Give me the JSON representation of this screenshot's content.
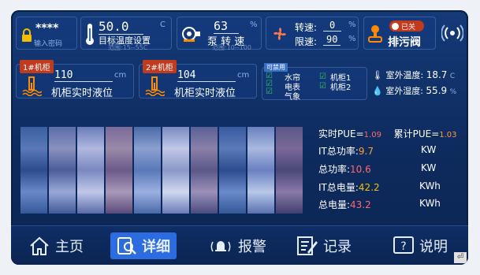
{
  "password": {
    "stars": "****",
    "label": "输入密码"
  },
  "target_temp": {
    "value": "50.0",
    "unit": "C",
    "label": "目标温度设置",
    "range": "范围:15--55C"
  },
  "pump_speed": {
    "value": "63",
    "unit": "%",
    "label": "泵 转 速",
    "range": "范围:10--100"
  },
  "fan": {
    "speed_label": "转速:",
    "speed_value": "0",
    "limit_label": "限速:",
    "limit_value": "90",
    "unit": "%"
  },
  "drain_valve": {
    "toggle": "已关",
    "label": "排污阀"
  },
  "cabinet1": {
    "tag": "1#机柜",
    "value": "110",
    "unit": "cm",
    "label": "机柜实时液位"
  },
  "cabinet2": {
    "tag": "2#机柜",
    "value": "104",
    "unit": "cm",
    "label": "机柜实时液位"
  },
  "enabled": {
    "tag": "可禁用",
    "items": [
      "水帘",
      "电表",
      "气象",
      "机柜1",
      "机柜2"
    ]
  },
  "outdoor": {
    "temp_label": "室外温度:",
    "temp_value": "18.7",
    "temp_unit": "C",
    "hum_label": "室外湿度:",
    "hum_value": "55.9",
    "hum_unit": "%"
  },
  "stats": {
    "realtime_pue_label": "实时PUE=",
    "realtime_pue": "1.09",
    "total_pue_label": "累计PUE=",
    "total_pue": "1.03",
    "it_power_label": "IT总功率:",
    "it_power": "9.7",
    "it_power_unit": "KW",
    "total_power_label": "总功率:",
    "total_power": "10.6",
    "total_power_unit": "KW",
    "it_energy_label": "IT总电量:",
    "it_energy": "42.2",
    "it_energy_unit": "KWh",
    "total_energy_label": "总电量:",
    "total_energy": "43.2",
    "total_energy_unit": "KWh"
  },
  "nav": {
    "home": "主页",
    "detail": "详细",
    "alarm": "报警",
    "record": "记录",
    "help": "说明"
  },
  "colors": {
    "accent": "#2d6ce0",
    "value_red": "#ff6a6a",
    "value_yellow": "#f0c000",
    "bg": "#0e2b5e"
  }
}
